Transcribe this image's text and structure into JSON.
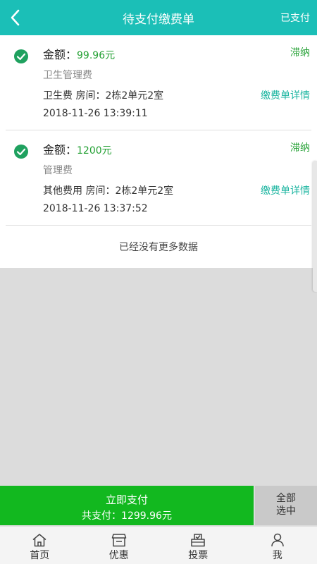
{
  "header": {
    "title": "待支付缴费单",
    "right_link": "已支付"
  },
  "bills": [
    {
      "amount_label": "金额：",
      "amount": "99.96元",
      "status": "滞纳",
      "category": "卫生管理费",
      "room": "卫生费  房间：2栋2单元2室",
      "detail_link": "缴费单详情",
      "time": "2018-11-26 13:39:11"
    },
    {
      "amount_label": "金额：",
      "amount": "1200元",
      "status": "滞纳",
      "category": "管理费",
      "room": "其他费用  房间：2栋2单元2室",
      "detail_link": "缴费单详情",
      "time": "2018-11-26 13:37:52"
    }
  ],
  "list_end": "已经没有更多数据",
  "pay": {
    "button_label": "立即支付",
    "total": "共支付：1299.96元",
    "select_all_line1": "全部",
    "select_all_line2": "选中"
  },
  "tabs": [
    {
      "label": "首页",
      "icon": "home-icon"
    },
    {
      "label": "优惠",
      "icon": "store-icon"
    },
    {
      "label": "投票",
      "icon": "vote-icon"
    },
    {
      "label": "我",
      "icon": "person-icon"
    }
  ],
  "colors": {
    "header": "#1bbfb7",
    "check": "#1fa15f",
    "amount": "#23a033",
    "detail_link": "#1bb5a0",
    "pay_button": "#12b81f"
  }
}
